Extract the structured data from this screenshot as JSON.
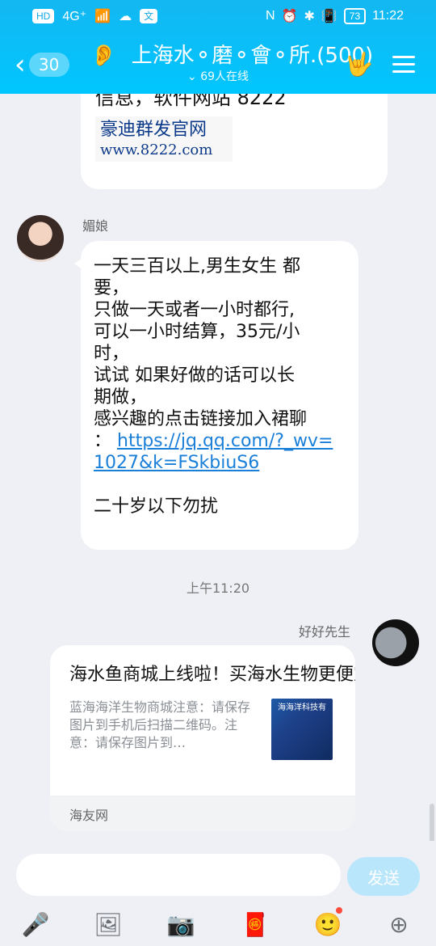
{
  "status_bar": {
    "left_badges": [
      "HD",
      "4G⁺",
      "📶",
      "☁",
      "文"
    ],
    "right_icons": [
      "N",
      "⏰",
      "✱",
      "📳"
    ],
    "battery": "73",
    "time": "11:22"
  },
  "header": {
    "unread_count": "30",
    "title": "上海水⚬磨⚬會⚬所.(500)",
    "online": "69人在线",
    "colors": {
      "bar": "#00c6ff",
      "text": "#ffffff"
    }
  },
  "messages": {
    "prev": {
      "partial_text": "信息，软件网站 8222",
      "image_line1": "豪迪群发官网",
      "image_line2": "www.8222.com"
    },
    "second": {
      "sender": "媚娘",
      "lines": [
        "一天三百以上,男生女生 都",
        "要，",
        "只做一天或者一小时都行,",
        "可以一小时结算，35元/小",
        "时，",
        "试试 如果好做的话可以长",
        "期做，",
        "感兴趣的点击链接加入裙聊",
        "："
      ],
      "link_part1": "https://jq.qq.com/?_wv=",
      "link_part2": "1027&k=FSkbiuS6",
      "last_line": "二十岁以下勿扰"
    },
    "time_divider": "上午11:20",
    "third": {
      "sender": "好好先生",
      "card_title": "海水鱼商城上线啦！买海水生物更便宜、更便捷…",
      "card_desc": "蓝海海洋生物商城注意：请保存图片到手机后扫描二维码。注意：请保存图片到…",
      "card_thumb_text": "海海洋科技有",
      "card_footer": "海友网"
    }
  },
  "input": {
    "placeholder": "",
    "send_label": "发送"
  },
  "toolbar": {
    "icons": [
      "microphone-icon",
      "image-icon",
      "camera-icon",
      "red-packet-icon",
      "emoji-icon",
      "plus-icon"
    ]
  }
}
